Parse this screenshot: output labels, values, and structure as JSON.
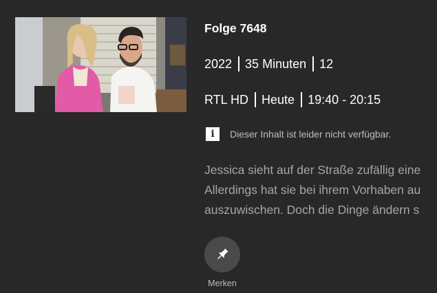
{
  "episode": {
    "title": "Folge 7648",
    "year": "2022",
    "duration": "35 Minuten",
    "age_rating": "12",
    "channel": "RTL HD",
    "day": "Heute",
    "time": "19:40 - 20:15"
  },
  "notice": {
    "icon": "info-icon",
    "text": "Dieser Inhalt ist leider nicht verfügbar."
  },
  "description": {
    "lines": [
      "Jessica sieht auf der Straße zufällig eine",
      "Allerdings hat sie bei ihrem Vorhaben au",
      "auszuwischen. Doch die Dinge ändern s"
    ]
  },
  "actions": {
    "pin_icon": "pin-icon",
    "pin_label": "Merken"
  }
}
